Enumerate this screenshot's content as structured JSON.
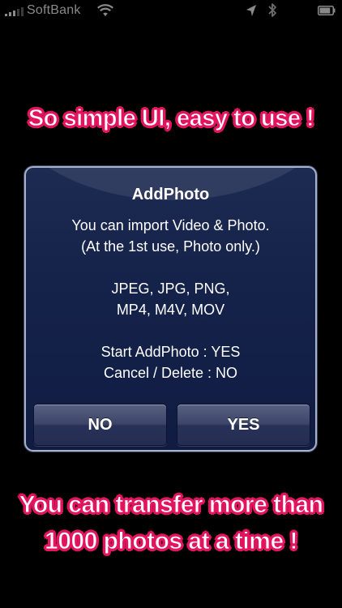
{
  "status_bar": {
    "carrier": "SoftBank",
    "signal_bars_filled": 3,
    "signal_bars_total": 5,
    "icons": [
      "signal-icon",
      "wifi-icon",
      "location-icon",
      "bluetooth-icon",
      "battery-icon"
    ],
    "battery_level": 0.85
  },
  "captions": {
    "top": "So simple UI, easy to use !",
    "bottom_line1": "You can transfer more than",
    "bottom_line2": "1000 photos at a time !"
  },
  "alert": {
    "title": "AddPhoto",
    "message": {
      "line1": "You can import Video & Photo.",
      "line2": "(At the 1st use, Photo only.)",
      "line3": "JPEG, JPG, PNG,",
      "line4": "MP4, M4V, MOV",
      "line5": "Start AddPhoto : YES",
      "line6": "Cancel / Delete : NO"
    },
    "buttons": {
      "no": "NO",
      "yes": "YES"
    }
  },
  "colors": {
    "background": "#000000",
    "caption_outline": "#e3155f",
    "caption_fill": "#ffffff",
    "alert_background": "#15224a",
    "alert_border": "#a7b2c8",
    "status_text": "#8a8a8a"
  }
}
